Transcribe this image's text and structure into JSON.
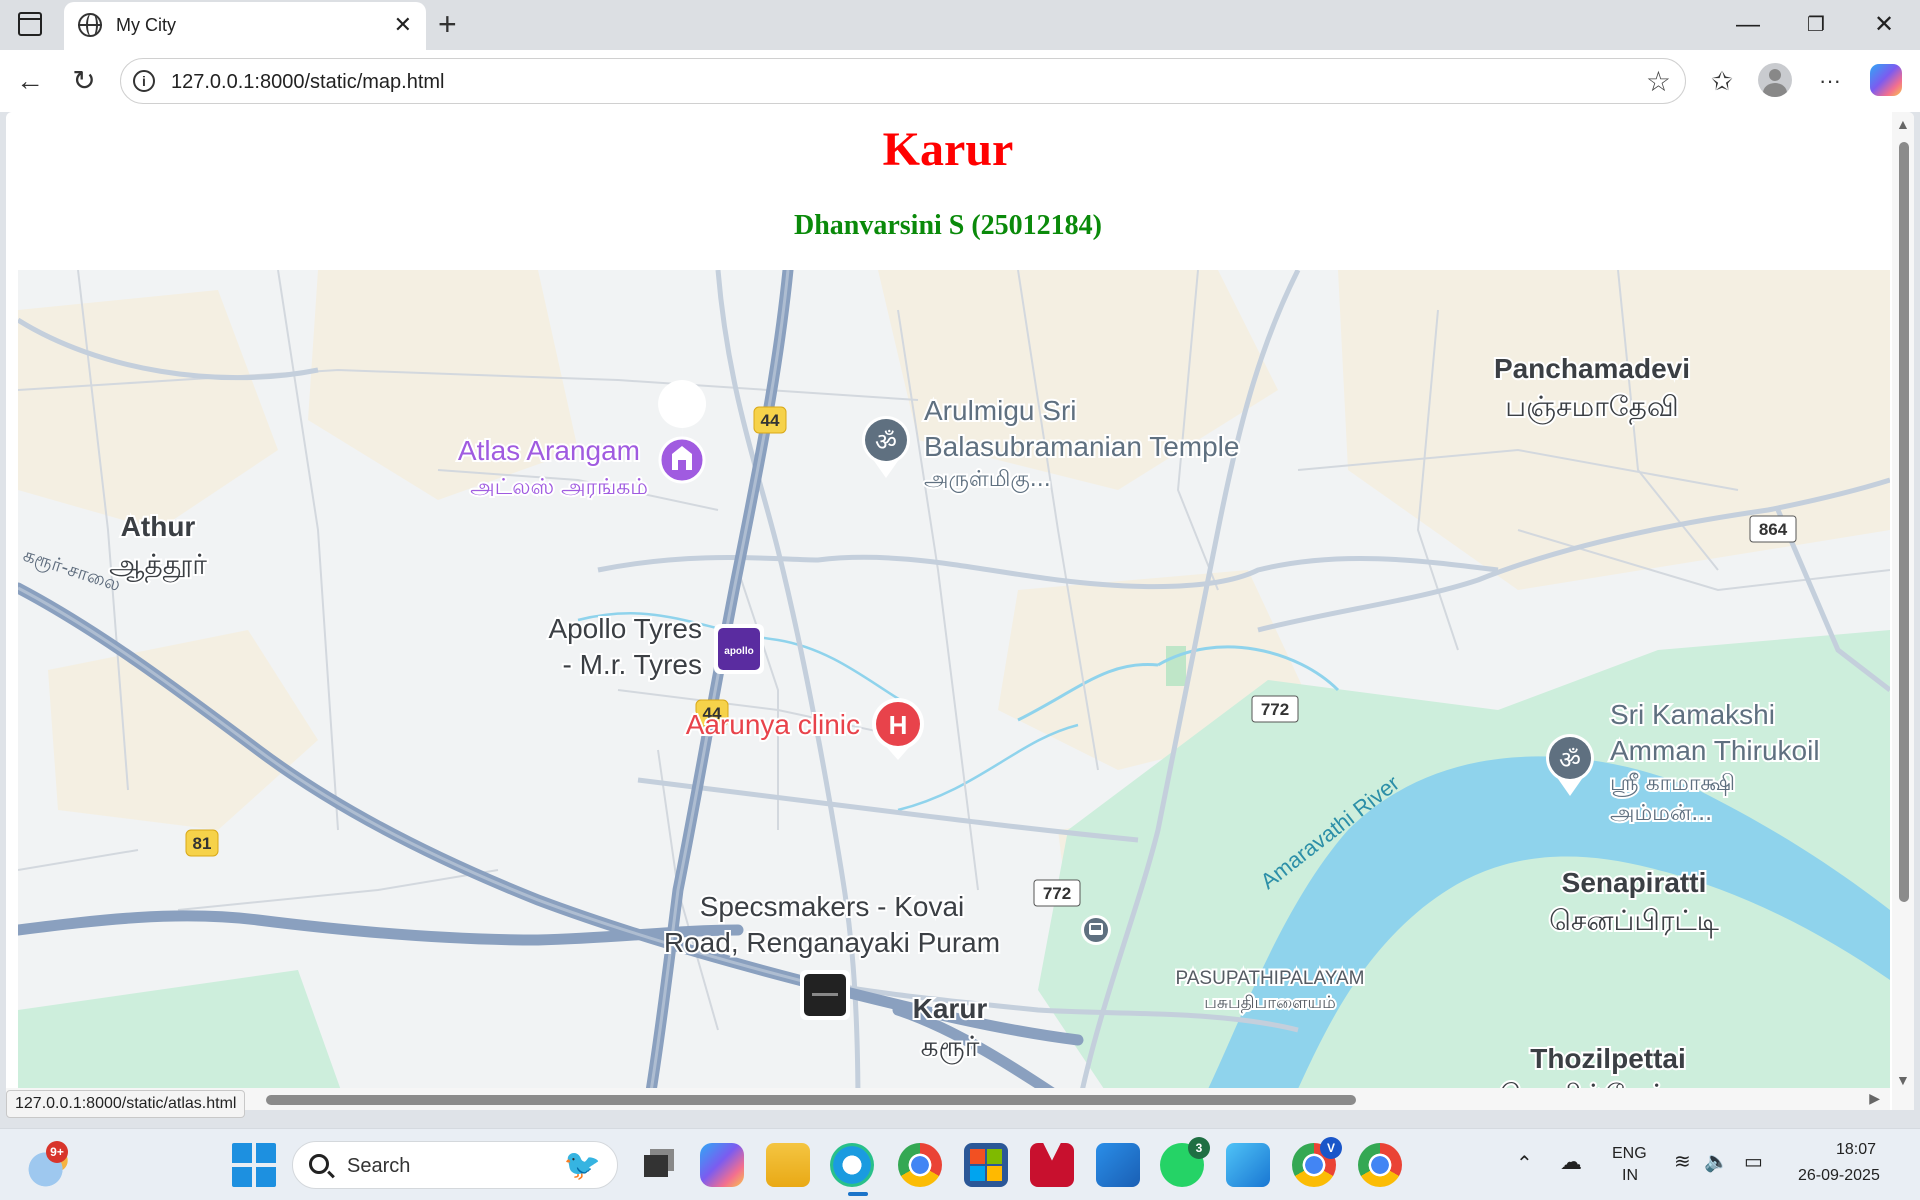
{
  "browser": {
    "tab_title": "My City",
    "url": "127.0.0.1:8000/static/map.html",
    "status_url": "127.0.0.1:8000/static/atlas.html"
  },
  "page": {
    "title": "Karur",
    "subtitle": "Dhanvarsini S (25012184)"
  },
  "map": {
    "places": [
      {
        "name": "Athur",
        "tamil": "ஆத்தூர்"
      },
      {
        "name": "Panchamadevi",
        "tamil": "பஞ்சமாதேவி"
      },
      {
        "name": "Senapiratti",
        "tamil": "செனப்பிரட்டி"
      },
      {
        "name": "Thozilpettai",
        "tamil": "தொழில்பேட்டை"
      },
      {
        "name": "Karur",
        "tamil": "கரூர்"
      },
      {
        "name": "PASUPATHIPALAYAM",
        "tamil": "பசுபதிபாளையம்"
      }
    ],
    "pois": [
      {
        "name": "Atlas Arangam",
        "tamil": "அட்லஸ் அரங்கம்",
        "icon": "theatre-icon",
        "color": "#a05be0"
      },
      {
        "name_line1": "Arulmigu Sri",
        "name_line2": "Balasubramanian Temple",
        "tamil": "அருள்மிகு...",
        "icon": "om-temple-icon",
        "color": "#5f7080"
      },
      {
        "name_line1": "Apollo Tyres",
        "name_line2": "- M.r. Tyres",
        "icon": "apollo-logo-icon",
        "color": "#5a2ca0"
      },
      {
        "name": "Aarunya clinic",
        "icon": "hospital-icon",
        "color": "#e8434b"
      },
      {
        "name_line1": "Sri Kamakshi",
        "name_line2": "Amman Thirukoil",
        "tamil_line1": "ஸ்ரீ காமாக்ஷி",
        "tamil_line2": "அம்மன்...",
        "icon": "om-temple-icon",
        "color": "#5f7080"
      },
      {
        "name_line1": "Specsmakers - Kovai",
        "name_line2": "Road, Renganayaki Puram",
        "icon": "store-icon",
        "color": "#222222"
      }
    ],
    "road_labels": [
      "44",
      "44",
      "81",
      "772",
      "772",
      "864"
    ],
    "river_label": "Amaravathi River",
    "road_name_tamil": "கரூர்-சாலை",
    "apollo_logo_text": "apollo"
  },
  "taskbar": {
    "search_placeholder": "Search",
    "weather_badge": "9+",
    "whatsapp_badge": "3",
    "chrome_badge": "V",
    "lang_line1": "ENG",
    "lang_line2": "IN",
    "time": "18:07",
    "date": "26-09-2025"
  },
  "colors": {
    "title": "#ff0000",
    "subtitle": "#0a8a0a",
    "river": "#8fd3ec",
    "park": "#cdeedc",
    "highway": "#8aa0bf"
  }
}
